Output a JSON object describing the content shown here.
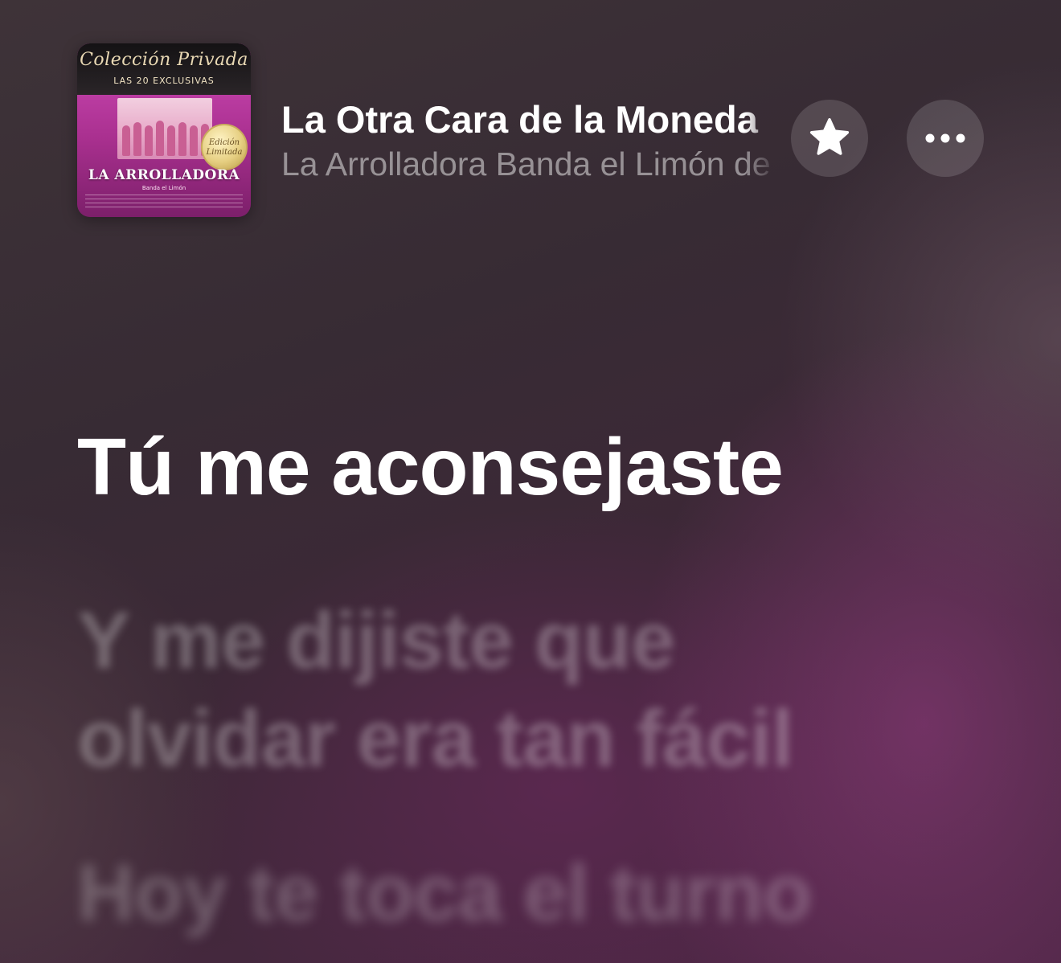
{
  "now_playing": {
    "album_art": {
      "series_title": "Colección Privada",
      "series_subtitle": "LAS 20 EXCLUSIVAS",
      "seal_text": "Edición Limitada",
      "band_name": "LA ARROLLADORA",
      "band_subtitle": "Banda el Limón",
      "brand_color": "#c43ea8"
    },
    "title": "La Otra Cara de la Moneda",
    "artist": "La Arrolladora Banda el Limón de René Camacho",
    "favorite_icon": "star-icon",
    "more_icon": "ellipsis-icon"
  },
  "lyrics": {
    "current_line": "Tú me aconsejaste",
    "next_lines": [
      "Y me dijiste que",
      "olvidar era tan fácil"
    ],
    "upcoming_line": "Hoy te toca el turno"
  }
}
